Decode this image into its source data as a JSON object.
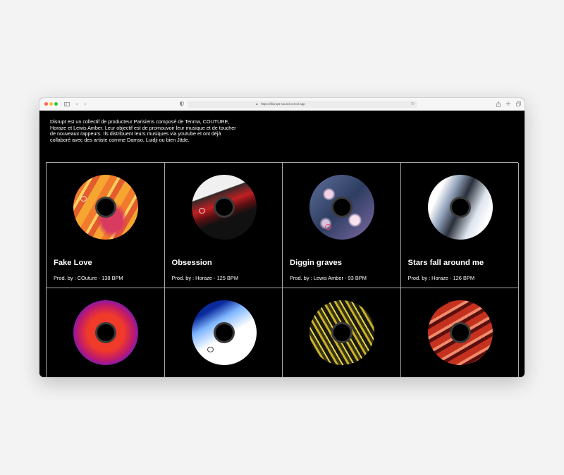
{
  "browser": {
    "url": "https://disrupt-sound.vercel.app",
    "icons": {
      "sidebar": "sidebar-icon",
      "back": "chevron-left-icon",
      "forward": "chevron-right-icon",
      "shield": "shield-icon",
      "lock": "lock-icon",
      "reload": "reload-icon",
      "share": "share-icon",
      "new_tab": "plus-icon",
      "tabs": "tabs-overview-icon"
    }
  },
  "intro": "Disrupt est un collectif de producteur Parisiens composé de Tenma, COUTURE, Horaze et Lewis Amber. Leur objectif est de promouvoir leur musique et de toucher de nouveaux rappeurs. Ils distribuent leurs musiques via youtube et ont déjà collaboré avec des artiste comme Damso, Luidji ou bien Jäde.",
  "tracks": [
    {
      "title": "Fake Love",
      "meta": "Prod. by : COuture - 138 BPM"
    },
    {
      "title": "Obsession",
      "meta": "Prod. by : Horaze - 125 BPM"
    },
    {
      "title": "Diggin graves",
      "meta": "Prod. by : Lewis Amber - 93 BPM"
    },
    {
      "title": "Stars fall around me",
      "meta": "Prod. by : Horaze - 126 BPM"
    },
    {
      "title": "",
      "meta": ""
    },
    {
      "title": "",
      "meta": ""
    },
    {
      "title": "",
      "meta": ""
    },
    {
      "title": "",
      "meta": ""
    }
  ],
  "colors": {
    "background": "#000000",
    "grid_lines": "#a9a9a9",
    "text": "#ffffff"
  }
}
